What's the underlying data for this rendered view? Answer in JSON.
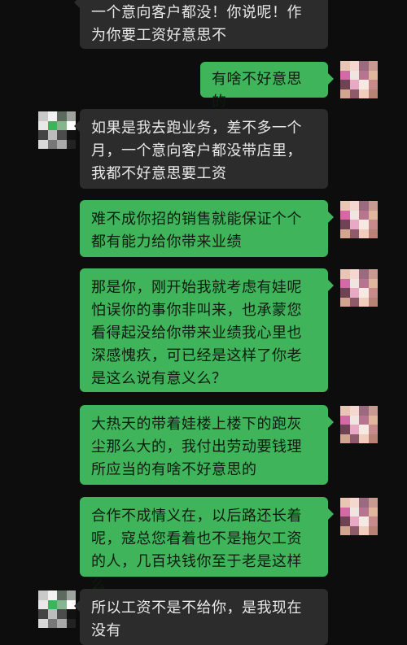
{
  "conversation": {
    "messages": [
      {
        "id": "m0",
        "from": "contact",
        "text": "一个意向客户都没！你说呢！作为你要工资好意思不"
      },
      {
        "id": "m1",
        "from": "me",
        "text": "有啥不好意思的"
      },
      {
        "id": "m2",
        "from": "contact",
        "text": "如果是我去跑业务，差不多一个月，一个意向客户都没带店里，我都不好意思要工资"
      },
      {
        "id": "m3",
        "from": "me",
        "text": "难不成你招的销售就能保证个个都有能力给你带来业绩"
      },
      {
        "id": "m4",
        "from": "me",
        "text": "那是你，刚开始我就考虑有娃呢怕误你的事你非叫来，也承蒙您看得起没给你带来业绩我心里也深感愧疚，可已经是这样了你老是这么说有意义么？"
      },
      {
        "id": "m5",
        "from": "me",
        "text": "大热天的带着娃楼上楼下的跑灰尘那么大的，我付出劳动要钱理所应当的有啥不好意思的"
      },
      {
        "id": "m6",
        "from": "me",
        "text": "合作不成情义在，以后路还长着呢，寇总您看着也不是拖欠工资的人，几百块钱你至于老是这样么"
      },
      {
        "id": "m7",
        "from": "contact",
        "text": "所以工资不是不给你，是我现在没有"
      }
    ]
  },
  "colors": {
    "background": "#0d0d0d",
    "incoming_bubble": "#2c2c2c",
    "outgoing_bubble": "#3fb45b"
  },
  "icons": {
    "contact_avatar": "contact-avatar-icon",
    "user_avatar": "user-avatar-icon"
  }
}
